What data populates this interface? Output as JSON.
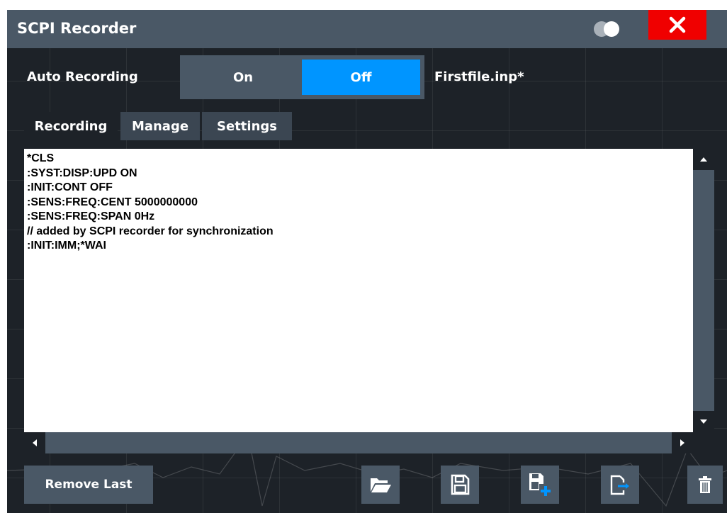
{
  "window": {
    "title": "SCPI Recorder",
    "close_icon": "close-icon",
    "transparency_icon": "transparency-toggle-icon"
  },
  "auto_recording": {
    "label": "Auto Recording",
    "on_label": "On",
    "off_label": "Off",
    "selected": "Off",
    "file_name": "Firstfile.inp*"
  },
  "tabs": [
    {
      "label": "Recording",
      "active": true
    },
    {
      "label": "Manage",
      "active": false
    },
    {
      "label": "Settings",
      "active": false
    }
  ],
  "recording": {
    "lines": [
      "*CLS",
      ":SYST:DISP:UPD ON",
      ":INIT:CONT OFF",
      ":SENS:FREQ:CENT 5000000000",
      ":SENS:FREQ:SPAN 0Hz",
      "// added by SCPI recorder for synchronization",
      ":INIT:IMM;*WAI"
    ]
  },
  "buttons": {
    "remove_last": "Remove Last",
    "open_icon": "folder-open-icon",
    "save_icon": "save-icon",
    "save_as_icon": "save-as-icon",
    "export_icon": "export-icon",
    "delete_icon": "trash-icon"
  },
  "colors": {
    "accent": "#0095ff",
    "close": "#f00000",
    "panel": "#4a5866",
    "background": "#1d2228"
  }
}
